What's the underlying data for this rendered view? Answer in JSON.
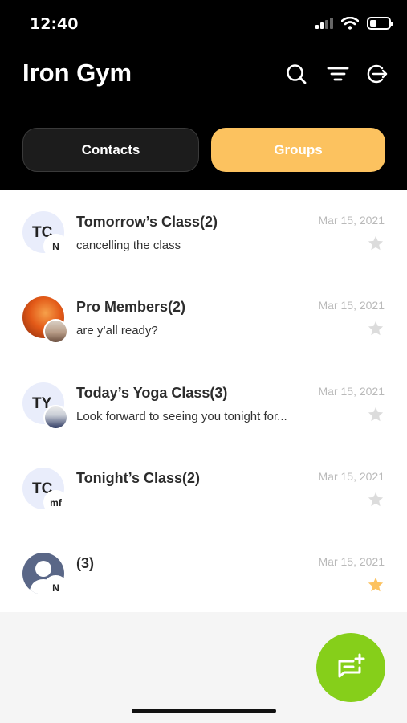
{
  "status_bar": {
    "time": "12:40"
  },
  "header": {
    "title": "Iron Gym",
    "icons": [
      "search-icon",
      "filter-icon",
      "logout-icon"
    ]
  },
  "tabs": [
    {
      "label": "Contacts",
      "active": false
    },
    {
      "label": "Groups",
      "active": true
    }
  ],
  "groups": [
    {
      "title": "Tomorrow’s Class(2)",
      "preview": "cancelling the class",
      "date": "Mar 15, 2021",
      "avatar_initials": "TC",
      "badge": "N",
      "starred": false
    },
    {
      "title": "Pro Members(2)",
      "preview": "are y’all ready?",
      "date": "Mar 15, 2021",
      "avatar_initials": "",
      "badge": "",
      "starred": false
    },
    {
      "title": "Today’s Yoga Class(3)",
      "preview": "Look forward to seeing you tonight for...",
      "date": "Mar 15, 2021",
      "avatar_initials": "TY",
      "badge": "",
      "starred": false
    },
    {
      "title": "Tonight’s Class(2)",
      "preview": "",
      "date": "Mar 15, 2021",
      "avatar_initials": "TC",
      "badge": "mf",
      "starred": false
    },
    {
      "title": "(3)",
      "preview": "",
      "date": "Mar 15, 2021",
      "avatar_initials": "",
      "badge": "N",
      "starred": true
    }
  ],
  "colors": {
    "accent": "#fcc25f",
    "fab": "#86cf1a",
    "star_on": "#fcc25f",
    "star_off": "#dcdcdc"
  },
  "fab_icon": "new-message-icon"
}
